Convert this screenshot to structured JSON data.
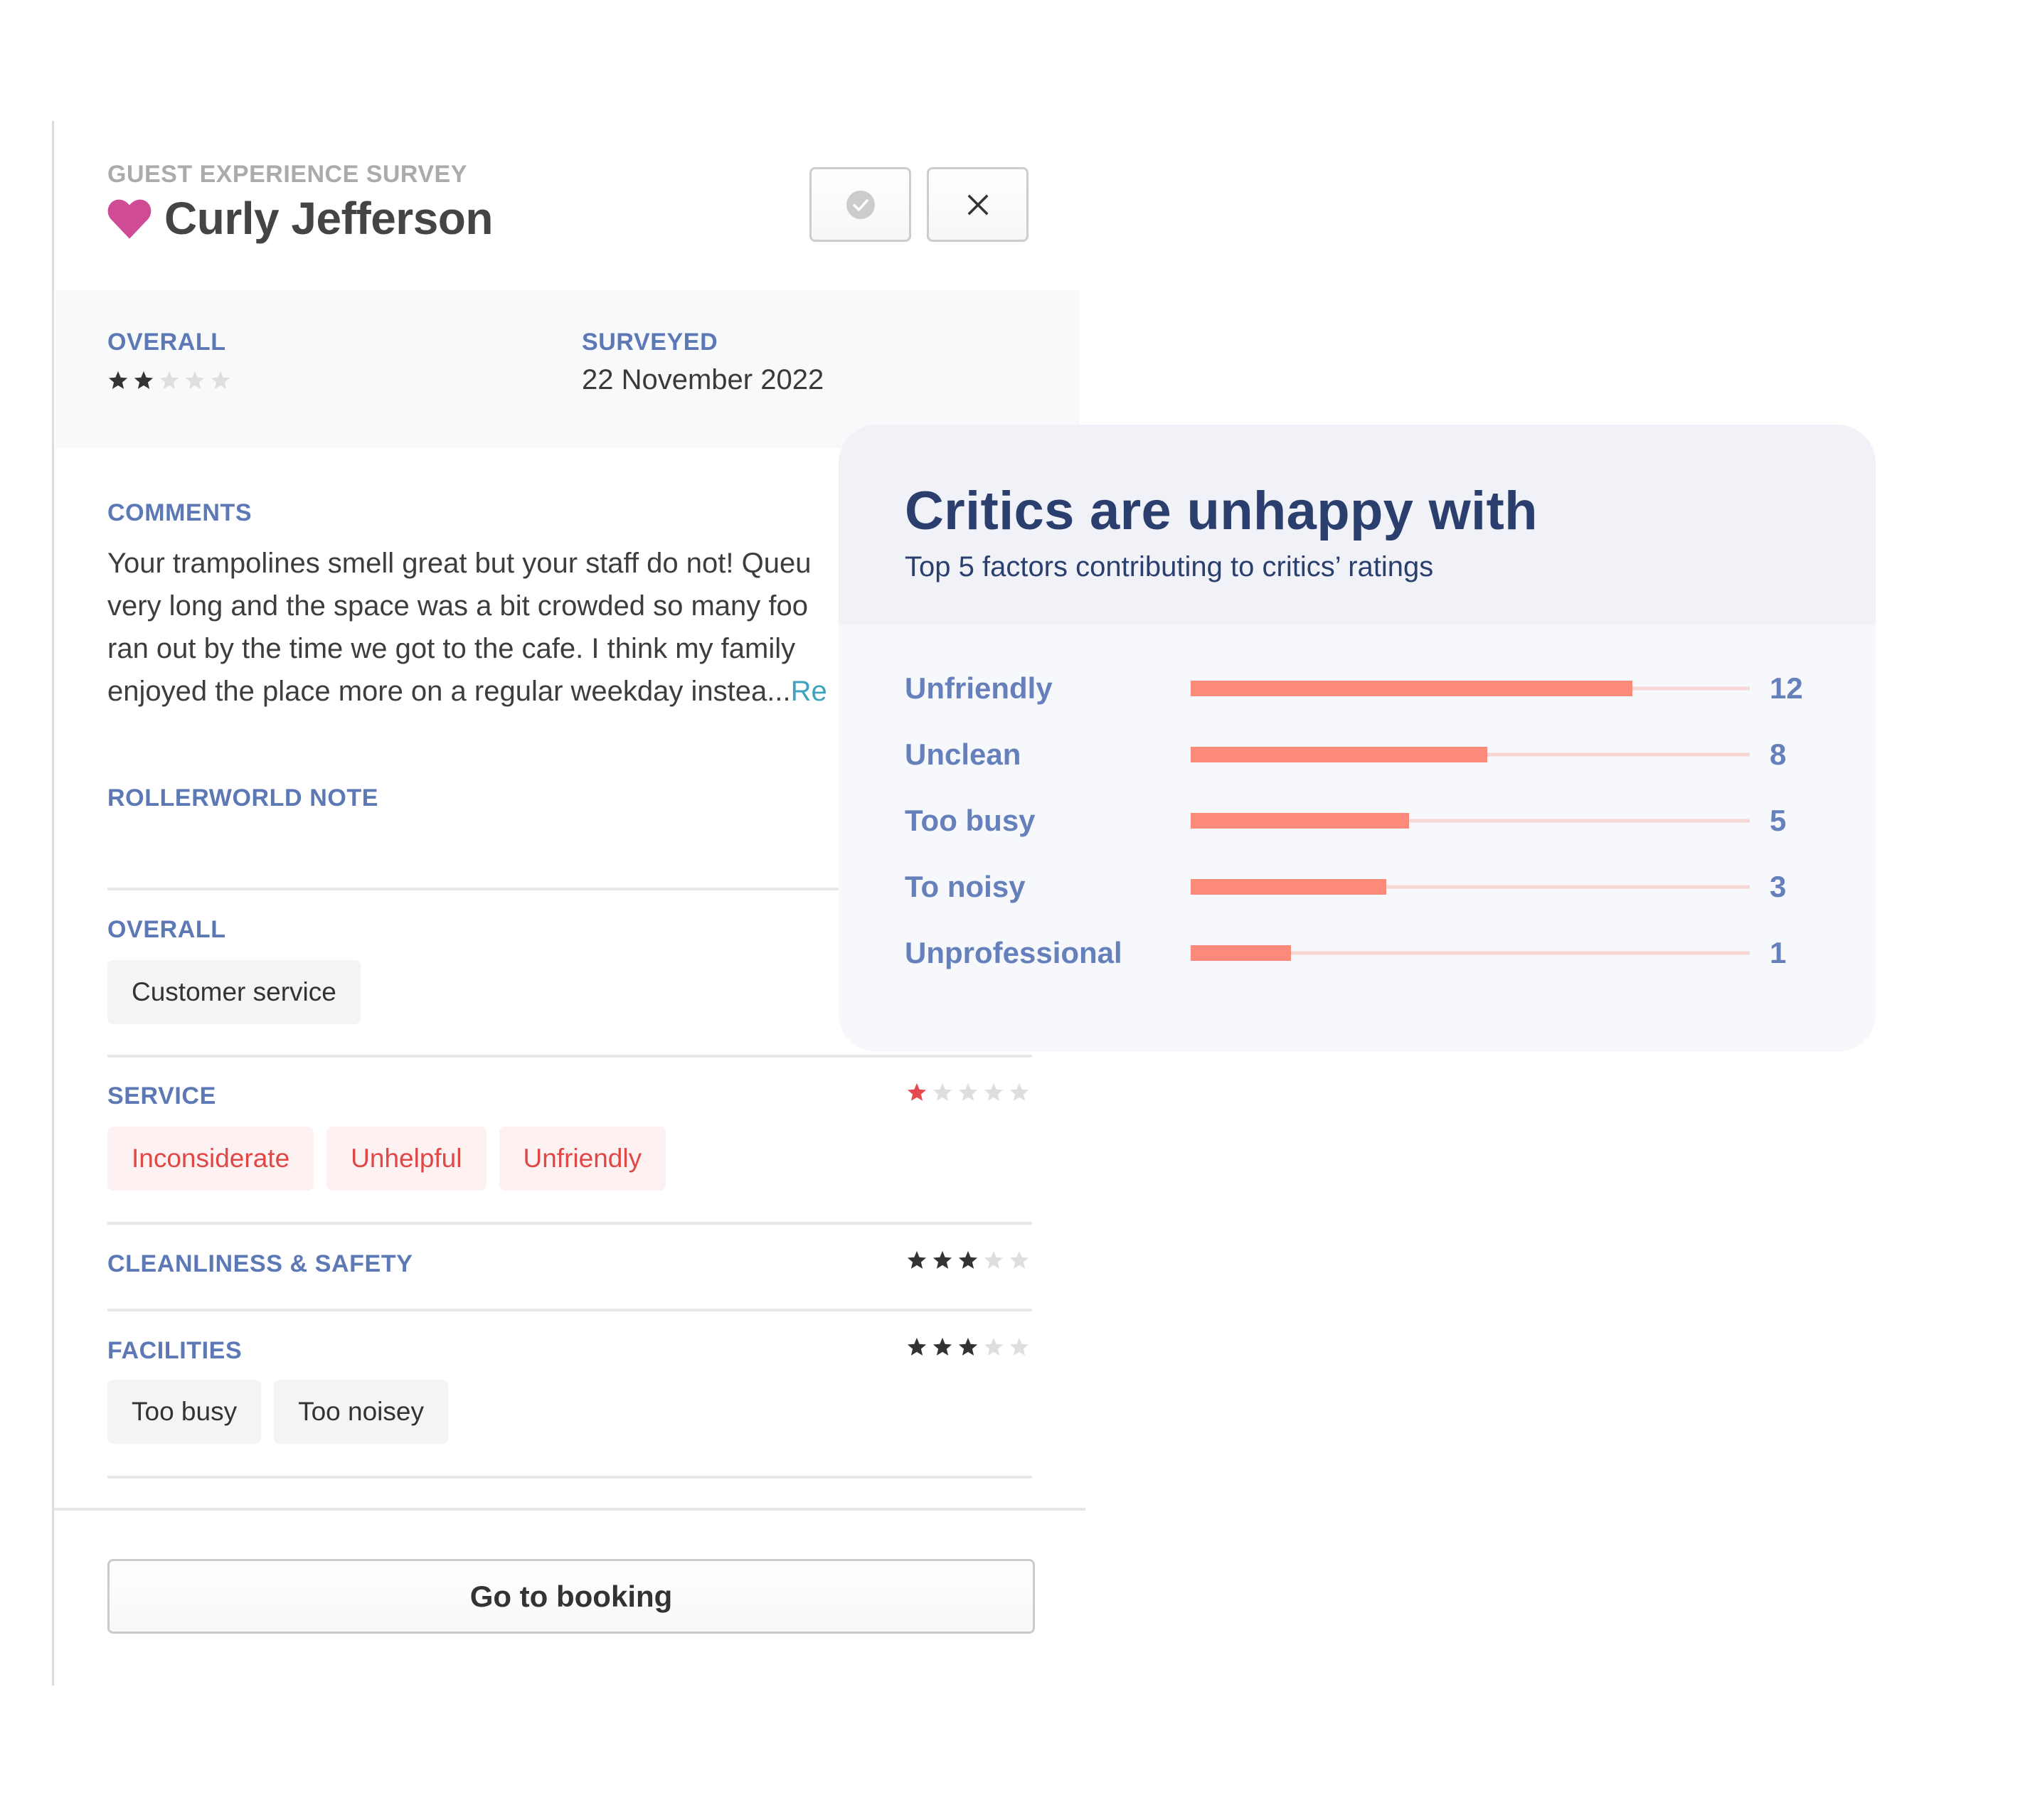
{
  "survey": {
    "eyebrow": "GUEST EXPERIENCE SURVEY",
    "guest_name": "Curly Jefferson",
    "heart_icon": "heart-icon",
    "heart_color": "#cf4c95",
    "actions": {
      "approve_icon": "check-circle-icon",
      "close_icon": "close-icon"
    },
    "overall_label": "OVERALL",
    "overall_rating": 2,
    "surveyed_label": "SURVEYED",
    "surveyed_date": "22 November 2022",
    "comments_label": "COMMENTS",
    "comment_lines": [
      "Your trampolines smell great but your staff do not! Queu",
      "very long and the space was a bit crowded so many foo",
      "ran out by the time we got to the cafe. I think my family",
      "enjoyed the place more on a regular weekday instea..."
    ],
    "read_more_label": "Re",
    "note_label": "ROLLERWORLD NOTE",
    "sections": [
      {
        "label": "OVERALL",
        "rating": null,
        "tags": [
          "Customer service"
        ],
        "tag_style": "neutral"
      },
      {
        "label": "SERVICE",
        "rating": 1,
        "rating_color": "#e64a4f",
        "tags": [
          "Inconsiderate",
          "Unhelpful",
          "Unfriendly"
        ],
        "tag_style": "negative"
      },
      {
        "label": "CLEANLINESS & SAFETY",
        "rating": 3,
        "tags": []
      },
      {
        "label": "FACILITIES",
        "rating": 3,
        "tags": [
          "Too busy",
          "Too noisey"
        ],
        "tag_style": "neutral"
      }
    ],
    "max_rating": 5,
    "go_to_booking_label": "Go to booking"
  },
  "colors": {
    "label_blue": "#5c78b5",
    "star_filled": "#333333",
    "star_empty": "#dedee0",
    "star_negative": "#e64a4f",
    "link": "#3fa3bf",
    "negative_tag_text": "#e04848",
    "negative_tag_bg": "#fdf2f1",
    "bar": "#fb8a7a",
    "bar_track": "#f8d6d3",
    "card_title": "#2b3f6e"
  },
  "critics_card": {
    "title": "Critics are unhappy with",
    "subtitle": "Top 5 factors contributing to critics’ ratings"
  },
  "chart_data": {
    "type": "bar",
    "orientation": "horizontal",
    "title": "Critics are unhappy with",
    "subtitle": "Top 5 factors contributing to critics’ ratings",
    "categories": [
      "Unfriendly",
      "Unclean",
      "Too busy",
      "To noisy",
      "Unprofessional"
    ],
    "values": [
      12,
      8,
      5,
      3,
      1
    ],
    "bar_fill_fraction": [
      0.79,
      0.53,
      0.39,
      0.35,
      0.18
    ],
    "xlabel": "",
    "ylabel": "",
    "grid": false,
    "legend": "none"
  }
}
